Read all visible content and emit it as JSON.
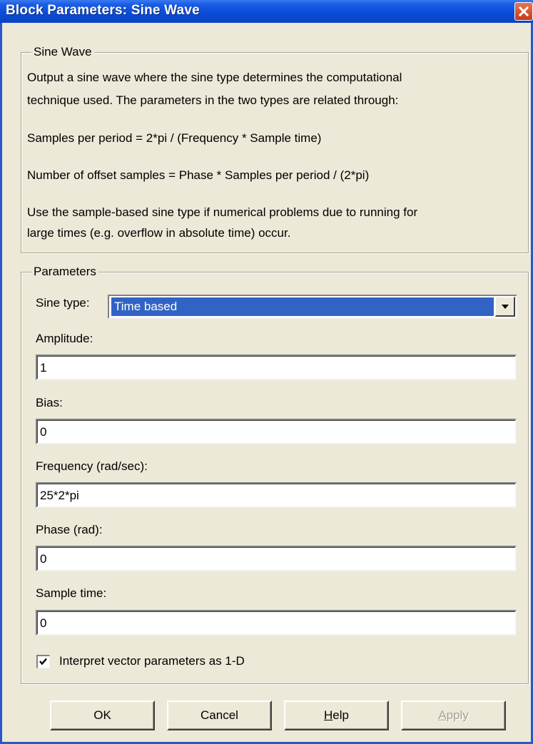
{
  "window": {
    "title": "Block Parameters: Sine Wave"
  },
  "description_group": {
    "legend": "Sine Wave",
    "lines": [
      "Output a sine wave where the sine type determines the computational",
      "technique used. The parameters in the two types are related through:",
      "Samples per period = 2*pi / (Frequency * Sample time)",
      "Number of offset samples = Phase * Samples per period / (2*pi)",
      "Use the sample-based sine type if numerical problems due to running for",
      "large times (e.g. overflow in absolute time) occur."
    ]
  },
  "parameters": {
    "legend": "Parameters",
    "sine_type": {
      "label": "Sine type:",
      "value": "Time based"
    },
    "amplitude": {
      "label": "Amplitude:",
      "value": "1"
    },
    "bias": {
      "label": "Bias:",
      "value": "0"
    },
    "frequency": {
      "label": "Frequency (rad/sec):",
      "value": "25*2*pi"
    },
    "phase": {
      "label": "Phase (rad):",
      "value": "0"
    },
    "sample_time": {
      "label": "Sample time:",
      "value": "0"
    },
    "interpret_vector": {
      "label": "Interpret vector parameters as 1-D",
      "checked": true
    }
  },
  "buttons": {
    "ok": "OK",
    "cancel": "Cancel",
    "help_mnemonic": "H",
    "help_rest": "elp",
    "apply_mnemonic": "A",
    "apply_rest": "pply"
  },
  "colors": {
    "titlebar": "#0a4bd6",
    "dialog_bg": "#ece9d8",
    "selection": "#3163c5"
  },
  "icons": {
    "close": "close-icon",
    "dropdown": "chevron-down-icon",
    "check": "checkmark-icon"
  }
}
